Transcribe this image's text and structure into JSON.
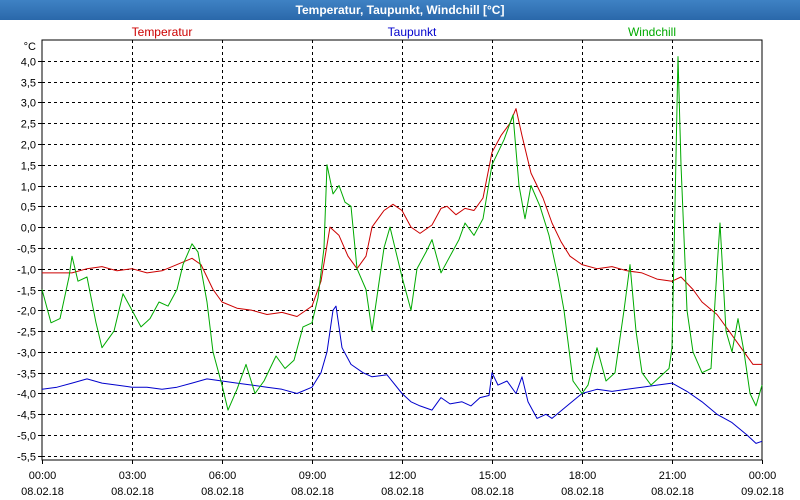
{
  "window_title": "Temperatur, Taupunkt, Windchill [°C]",
  "chart_data": {
    "type": "line",
    "title": "Temperatur, Taupunkt, Windchill [°C]",
    "ylabel": "°C",
    "ylim": [
      -5.6,
      4.5
    ],
    "grid": true,
    "legend_placement": "top",
    "x_ticks": [
      {
        "time": "00:00",
        "date": "08.02.18"
      },
      {
        "time": "03:00",
        "date": "08.02.18"
      },
      {
        "time": "06:00",
        "date": "08.02.18"
      },
      {
        "time": "09:00",
        "date": "08.02.18"
      },
      {
        "time": "12:00",
        "date": "08.02.18"
      },
      {
        "time": "15:00",
        "date": "08.02.18"
      },
      {
        "time": "18:00",
        "date": "08.02.18"
      },
      {
        "time": "21:00",
        "date": "08.02.18"
      },
      {
        "time": "00:00",
        "date": "09.02.18"
      }
    ],
    "y_ticks": [
      "4,0",
      "3,5",
      "3,0",
      "2,5",
      "2,0",
      "1,5",
      "1,0",
      "0,5",
      "0,0",
      "-0,5",
      "-1,0",
      "-1,5",
      "-2,0",
      "-2,5",
      "-3,0",
      "-3,5",
      "-4,0",
      "-4,5",
      "-5,0",
      "-5,5"
    ],
    "y_tick_values": [
      4.0,
      3.5,
      3.0,
      2.5,
      2.0,
      1.5,
      1.0,
      0.5,
      0.0,
      -0.5,
      -1.0,
      -1.5,
      -2.0,
      -2.5,
      -3.0,
      -3.5,
      -4.0,
      -4.5,
      -5.0,
      -5.5
    ],
    "series": [
      {
        "name": "Temperatur",
        "color": "#cc0000",
        "points": [
          [
            0,
            -1.1
          ],
          [
            0.5,
            -1.1
          ],
          [
            1,
            -1.1
          ],
          [
            1.5,
            -1.0
          ],
          [
            2,
            -0.95
          ],
          [
            2.5,
            -1.05
          ],
          [
            3,
            -1.0
          ],
          [
            3.5,
            -1.1
          ],
          [
            4,
            -1.05
          ],
          [
            4.5,
            -0.9
          ],
          [
            5,
            -0.75
          ],
          [
            5.3,
            -0.9
          ],
          [
            5.7,
            -1.5
          ],
          [
            6,
            -1.8
          ],
          [
            6.5,
            -1.95
          ],
          [
            7,
            -2.0
          ],
          [
            7.5,
            -2.1
          ],
          [
            8,
            -2.05
          ],
          [
            8.5,
            -2.15
          ],
          [
            9,
            -1.9
          ],
          [
            9.3,
            -1.3
          ],
          [
            9.6,
            0.0
          ],
          [
            9.9,
            -0.2
          ],
          [
            10.2,
            -0.7
          ],
          [
            10.5,
            -1.0
          ],
          [
            10.8,
            -0.7
          ],
          [
            11.0,
            0.0
          ],
          [
            11.4,
            0.4
          ],
          [
            11.7,
            0.55
          ],
          [
            12.0,
            0.4
          ],
          [
            12.3,
            0.0
          ],
          [
            12.6,
            -0.15
          ],
          [
            13.0,
            0.05
          ],
          [
            13.3,
            0.45
          ],
          [
            13.5,
            0.5
          ],
          [
            13.8,
            0.3
          ],
          [
            14.1,
            0.45
          ],
          [
            14.4,
            0.4
          ],
          [
            14.7,
            0.7
          ],
          [
            15.0,
            1.8
          ],
          [
            15.3,
            2.2
          ],
          [
            15.6,
            2.5
          ],
          [
            15.8,
            2.85
          ],
          [
            16.0,
            2.2
          ],
          [
            16.3,
            1.3
          ],
          [
            16.7,
            0.7
          ],
          [
            17.0,
            0.1
          ],
          [
            17.3,
            -0.35
          ],
          [
            17.6,
            -0.7
          ],
          [
            18.0,
            -0.9
          ],
          [
            18.5,
            -1.0
          ],
          [
            19.0,
            -0.95
          ],
          [
            19.5,
            -1.05
          ],
          [
            20.0,
            -1.1
          ],
          [
            20.5,
            -1.25
          ],
          [
            21.0,
            -1.3
          ],
          [
            21.3,
            -1.2
          ],
          [
            21.7,
            -1.5
          ],
          [
            22.0,
            -1.8
          ],
          [
            22.5,
            -2.1
          ],
          [
            23.0,
            -2.6
          ],
          [
            23.4,
            -3.0
          ],
          [
            23.7,
            -3.3
          ],
          [
            24.0,
            -3.3
          ]
        ]
      },
      {
        "name": "Taupunkt",
        "color": "#0000cc",
        "points": [
          [
            0,
            -3.9
          ],
          [
            0.5,
            -3.85
          ],
          [
            1,
            -3.75
          ],
          [
            1.5,
            -3.65
          ],
          [
            2,
            -3.75
          ],
          [
            2.5,
            -3.8
          ],
          [
            3,
            -3.85
          ],
          [
            3.5,
            -3.85
          ],
          [
            4,
            -3.9
          ],
          [
            4.5,
            -3.85
          ],
          [
            5,
            -3.75
          ],
          [
            5.5,
            -3.65
          ],
          [
            6,
            -3.7
          ],
          [
            6.5,
            -3.75
          ],
          [
            7,
            -3.8
          ],
          [
            7.5,
            -3.85
          ],
          [
            8,
            -3.9
          ],
          [
            8.5,
            -4.0
          ],
          [
            9,
            -3.85
          ],
          [
            9.3,
            -3.5
          ],
          [
            9.5,
            -3.0
          ],
          [
            9.7,
            -2.0
          ],
          [
            9.8,
            -1.9
          ],
          [
            10.0,
            -2.9
          ],
          [
            10.3,
            -3.3
          ],
          [
            10.7,
            -3.5
          ],
          [
            11.0,
            -3.6
          ],
          [
            11.5,
            -3.55
          ],
          [
            12.0,
            -4.0
          ],
          [
            12.3,
            -4.2
          ],
          [
            12.6,
            -4.3
          ],
          [
            13.0,
            -4.4
          ],
          [
            13.3,
            -4.1
          ],
          [
            13.6,
            -4.25
          ],
          [
            14.0,
            -4.2
          ],
          [
            14.3,
            -4.3
          ],
          [
            14.6,
            -4.1
          ],
          [
            14.9,
            -4.05
          ],
          [
            15.0,
            -3.5
          ],
          [
            15.2,
            -3.8
          ],
          [
            15.5,
            -3.7
          ],
          [
            15.8,
            -4.0
          ],
          [
            16.0,
            -3.6
          ],
          [
            16.2,
            -4.2
          ],
          [
            16.5,
            -4.6
          ],
          [
            16.8,
            -4.5
          ],
          [
            17.0,
            -4.6
          ],
          [
            17.5,
            -4.3
          ],
          [
            18.0,
            -4.0
          ],
          [
            18.5,
            -3.9
          ],
          [
            19.0,
            -3.95
          ],
          [
            19.5,
            -3.9
          ],
          [
            20.0,
            -3.85
          ],
          [
            20.5,
            -3.8
          ],
          [
            21.0,
            -3.75
          ],
          [
            21.5,
            -3.95
          ],
          [
            22.0,
            -4.2
          ],
          [
            22.5,
            -4.5
          ],
          [
            23.0,
            -4.7
          ],
          [
            23.5,
            -5.0
          ],
          [
            23.8,
            -5.2
          ],
          [
            24.0,
            -5.15
          ]
        ]
      },
      {
        "name": "Windchill",
        "color": "#00aa00",
        "points": [
          [
            0,
            -1.5
          ],
          [
            0.3,
            -2.3
          ],
          [
            0.6,
            -2.2
          ],
          [
            0.9,
            -1.2
          ],
          [
            1.0,
            -0.7
          ],
          [
            1.2,
            -1.3
          ],
          [
            1.5,
            -1.2
          ],
          [
            1.8,
            -2.3
          ],
          [
            2.0,
            -2.9
          ],
          [
            2.4,
            -2.5
          ],
          [
            2.7,
            -1.6
          ],
          [
            3.0,
            -2.0
          ],
          [
            3.3,
            -2.4
          ],
          [
            3.6,
            -2.2
          ],
          [
            3.9,
            -1.8
          ],
          [
            4.2,
            -1.9
          ],
          [
            4.5,
            -1.5
          ],
          [
            4.7,
            -0.9
          ],
          [
            5.0,
            -0.4
          ],
          [
            5.2,
            -0.6
          ],
          [
            5.5,
            -1.8
          ],
          [
            5.7,
            -3.0
          ],
          [
            6.0,
            -3.8
          ],
          [
            6.2,
            -4.4
          ],
          [
            6.5,
            -3.9
          ],
          [
            6.8,
            -3.3
          ],
          [
            7.1,
            -4.0
          ],
          [
            7.4,
            -3.7
          ],
          [
            7.8,
            -3.1
          ],
          [
            8.1,
            -3.4
          ],
          [
            8.4,
            -3.2
          ],
          [
            8.7,
            -2.4
          ],
          [
            9.0,
            -2.3
          ],
          [
            9.2,
            -1.7
          ],
          [
            9.4,
            -0.5
          ],
          [
            9.5,
            1.5
          ],
          [
            9.7,
            0.8
          ],
          [
            9.9,
            1.0
          ],
          [
            10.1,
            0.6
          ],
          [
            10.3,
            0.5
          ],
          [
            10.5,
            -1.0
          ],
          [
            10.8,
            -1.5
          ],
          [
            11.0,
            -2.5
          ],
          [
            11.2,
            -1.5
          ],
          [
            11.4,
            -0.5
          ],
          [
            11.6,
            0.0
          ],
          [
            11.8,
            -0.6
          ],
          [
            12.0,
            -1.2
          ],
          [
            12.3,
            -2.0
          ],
          [
            12.5,
            -1.0
          ],
          [
            12.8,
            -0.6
          ],
          [
            13.0,
            -0.3
          ],
          [
            13.3,
            -1.1
          ],
          [
            13.6,
            -0.7
          ],
          [
            13.9,
            -0.3
          ],
          [
            14.1,
            0.1
          ],
          [
            14.4,
            -0.2
          ],
          [
            14.7,
            0.2
          ],
          [
            15.0,
            1.5
          ],
          [
            15.2,
            1.8
          ],
          [
            15.4,
            2.1
          ],
          [
            15.7,
            2.7
          ],
          [
            15.9,
            1.0
          ],
          [
            16.1,
            0.2
          ],
          [
            16.3,
            1.0
          ],
          [
            16.6,
            0.5
          ],
          [
            16.9,
            -0.2
          ],
          [
            17.2,
            -1.2
          ],
          [
            17.4,
            -2.0
          ],
          [
            17.7,
            -3.7
          ],
          [
            18.0,
            -4.0
          ],
          [
            18.2,
            -3.8
          ],
          [
            18.5,
            -2.9
          ],
          [
            18.8,
            -3.7
          ],
          [
            19.1,
            -3.5
          ],
          [
            19.4,
            -2.0
          ],
          [
            19.6,
            -0.9
          ],
          [
            19.8,
            -2.5
          ],
          [
            20.0,
            -3.5
          ],
          [
            20.3,
            -3.8
          ],
          [
            20.6,
            -3.6
          ],
          [
            20.9,
            -3.4
          ],
          [
            21.0,
            -2.9
          ],
          [
            21.1,
            0.5
          ],
          [
            21.2,
            4.1
          ],
          [
            21.3,
            1.5
          ],
          [
            21.5,
            -2.0
          ],
          [
            21.7,
            -3.0
          ],
          [
            22.0,
            -3.5
          ],
          [
            22.3,
            -3.4
          ],
          [
            22.5,
            -1.0
          ],
          [
            22.6,
            0.1
          ],
          [
            22.8,
            -2.5
          ],
          [
            23.0,
            -3.0
          ],
          [
            23.2,
            -2.2
          ],
          [
            23.4,
            -3.0
          ],
          [
            23.6,
            -4.0
          ],
          [
            23.8,
            -4.3
          ],
          [
            24.0,
            -3.8
          ]
        ]
      }
    ]
  }
}
